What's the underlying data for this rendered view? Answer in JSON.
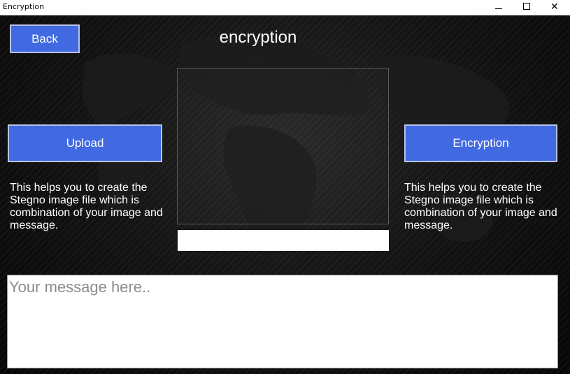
{
  "window": {
    "title": "Encryption",
    "controls": {
      "minimize": "—",
      "maximize": "☐",
      "close": "✕"
    }
  },
  "header": {
    "back_label": "Back",
    "title": "encryption"
  },
  "left_panel": {
    "upload_label": "Upload",
    "description": "This helps you to create the Stegno image file which is combination of your image and message."
  },
  "right_panel": {
    "encrypt_label": "Encryption",
    "description": "This helps you to create the Stegno image file which is combination of your image and message."
  },
  "center": {
    "file_path_value": ""
  },
  "message_box": {
    "placeholder": "Your message here..",
    "value": ""
  },
  "colors": {
    "button": "#4169e1",
    "background": "#0c0c0c",
    "text": "#ffffff"
  }
}
